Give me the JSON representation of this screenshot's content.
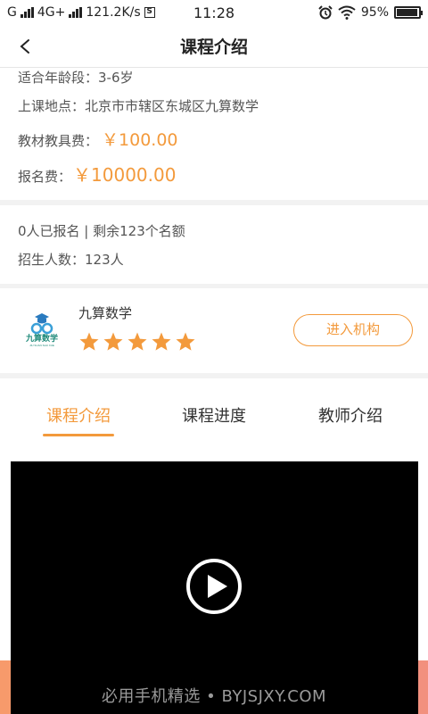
{
  "status_bar": {
    "carrier": "G",
    "network": "4G+",
    "speed": "121.2K/s",
    "s_badge": "S",
    "time": "11:28",
    "battery": "95%",
    "battery_level": 0.95
  },
  "nav": {
    "title": "课程介绍"
  },
  "info": {
    "age_line": "适合年龄段：3-6岁",
    "location_line": "上课地点：北京市市辖区东城区九算数学",
    "material_label": "教材教具费：",
    "material_price": "￥100.00",
    "fee_label": "报名费：",
    "fee_price": "￥10000.00"
  },
  "enroll": {
    "status_line": "0人已报名 | 剩余123个名额",
    "quota_line": "招生人数：123人"
  },
  "org": {
    "name": "九算数学",
    "logo_text": "九算数学",
    "logo_sub": "JIU SUAN SHU XUE",
    "rating": 5,
    "enter_label": "进入机构",
    "accent": "#f39a3c"
  },
  "tabs": [
    {
      "label": "课程介绍",
      "active": true
    },
    {
      "label": "课程进度",
      "active": false
    },
    {
      "label": "教师介绍",
      "active": false
    }
  ],
  "watermark": "必用手机精选 • BYJSJXY.COM"
}
